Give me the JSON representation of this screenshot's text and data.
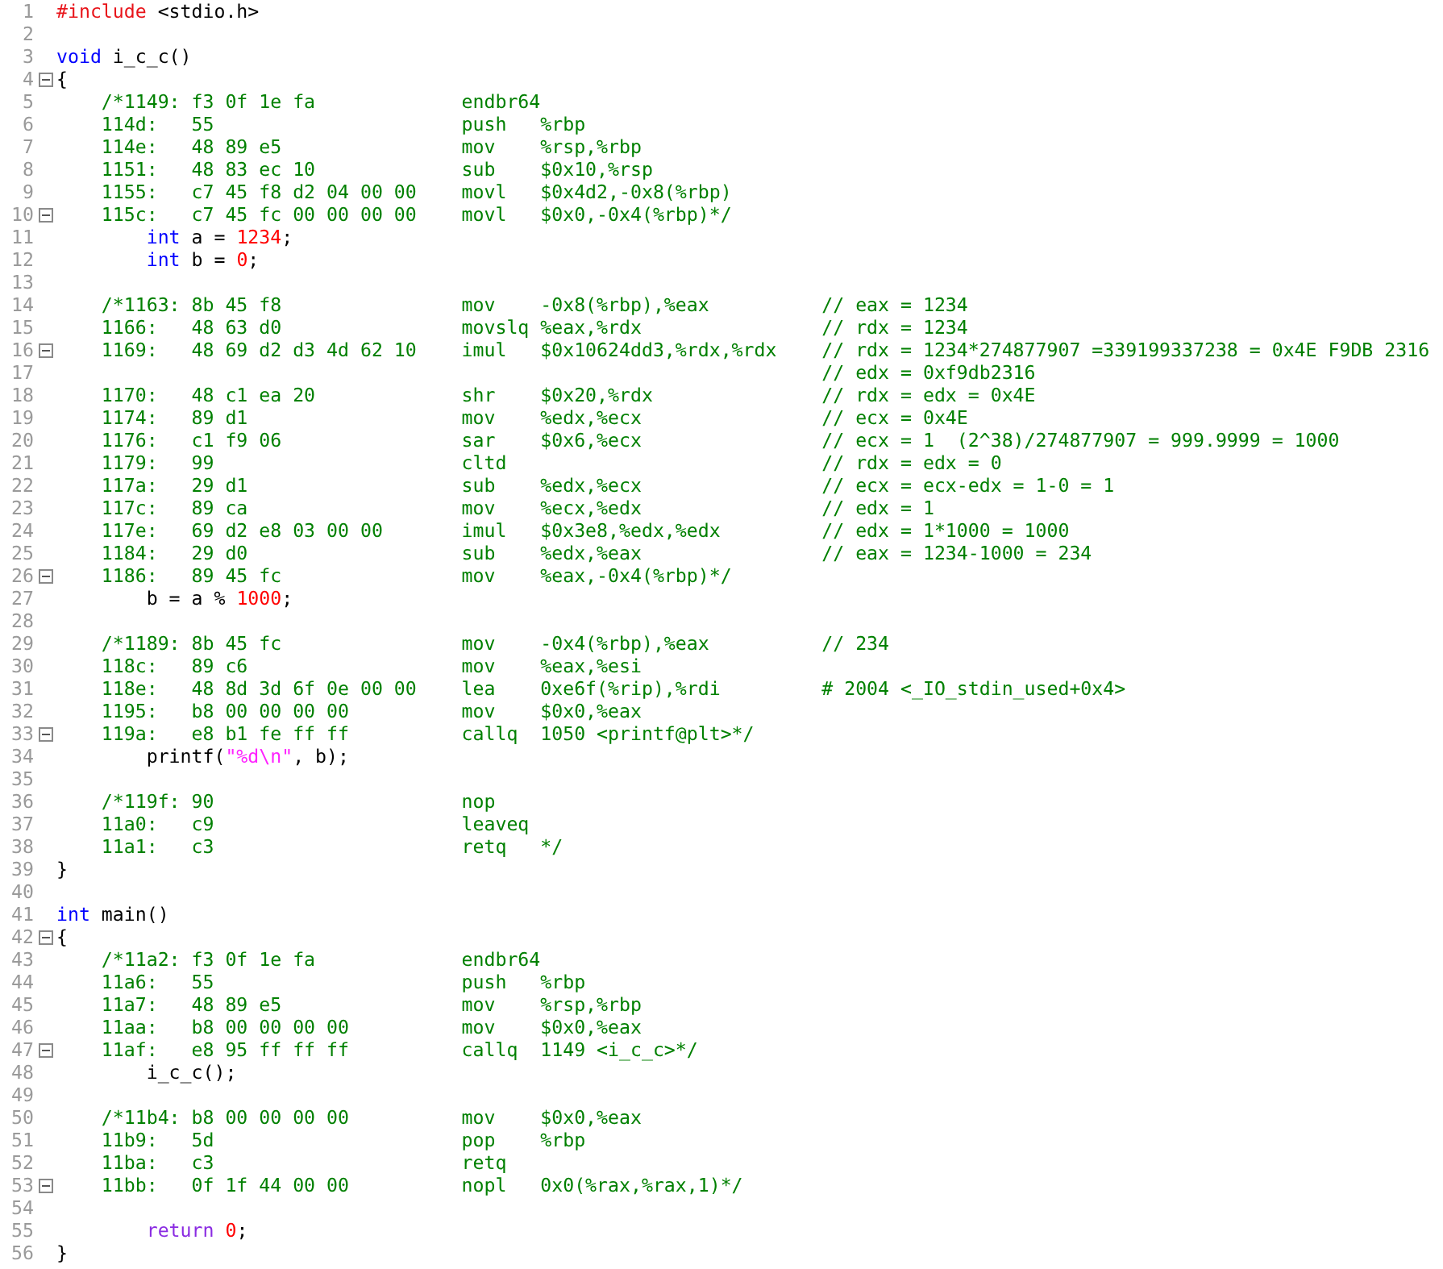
{
  "editor": {
    "lines": [
      {
        "number": "1",
        "fold": false,
        "kind": "source",
        "tokens": [
          {
            "kind": "preproc",
            "text": "#include"
          },
          {
            "kind": "plain",
            "text": " <stdio.h>"
          }
        ]
      },
      {
        "number": "2",
        "fold": false,
        "kind": "blank"
      },
      {
        "number": "3",
        "fold": false,
        "kind": "source",
        "tokens": [
          {
            "kind": "keyword",
            "text": "void"
          },
          {
            "kind": "plain",
            "text": " i_c_c()"
          }
        ]
      },
      {
        "number": "4",
        "fold": true,
        "kind": "source",
        "tokens": [
          {
            "kind": "plain",
            "text": "{"
          }
        ]
      },
      {
        "number": "5",
        "fold": false,
        "kind": "asm",
        "addr": "/*1149:",
        "bytes": "f3 0f 1e fa",
        "op": "endbr64"
      },
      {
        "number": "6",
        "fold": false,
        "kind": "asm",
        "addr": "114d:",
        "bytes": "55",
        "op": "push",
        "args": "%rbp"
      },
      {
        "number": "7",
        "fold": false,
        "kind": "asm",
        "addr": "114e:",
        "bytes": "48 89 e5",
        "op": "mov",
        "args": "%rsp,%rbp"
      },
      {
        "number": "8",
        "fold": false,
        "kind": "asm",
        "addr": "1151:",
        "bytes": "48 83 ec 10",
        "op": "sub",
        "args": "$0x10,%rsp"
      },
      {
        "number": "9",
        "fold": false,
        "kind": "asm",
        "addr": "1155:",
        "bytes": "c7 45 f8 d2 04 00 00",
        "op": "movl",
        "args": "$0x4d2,-0x8(%rbp)"
      },
      {
        "number": "10",
        "fold": true,
        "kind": "asm",
        "addr": "115c:",
        "bytes": "c7 45 fc 00 00 00 00",
        "op": "movl",
        "args": "$0x0,-0x4(%rbp)*/"
      },
      {
        "number": "11",
        "fold": false,
        "kind": "source",
        "tokens": [
          {
            "kind": "keyword",
            "text": "        int"
          },
          {
            "kind": "plain",
            "text": " a = "
          },
          {
            "kind": "number",
            "text": "1234"
          },
          {
            "kind": "plain",
            "text": ";"
          }
        ]
      },
      {
        "number": "12",
        "fold": false,
        "kind": "source",
        "tokens": [
          {
            "kind": "keyword",
            "text": "        int"
          },
          {
            "kind": "plain",
            "text": " b = "
          },
          {
            "kind": "number",
            "text": "0"
          },
          {
            "kind": "plain",
            "text": ";"
          }
        ]
      },
      {
        "number": "13",
        "fold": false,
        "kind": "blank"
      },
      {
        "number": "14",
        "fold": false,
        "kind": "asm",
        "addr": "/*1163:",
        "bytes": "8b 45 f8",
        "op": "mov",
        "args": "-0x8(%rbp),%eax",
        "note": "// eax = 1234"
      },
      {
        "number": "15",
        "fold": false,
        "kind": "asm",
        "addr": "1166:",
        "bytes": "48 63 d0",
        "op": "movslq",
        "args": "%eax,%rdx",
        "note": "// rdx = 1234"
      },
      {
        "number": "16",
        "fold": true,
        "kind": "asm",
        "addr": "1169:",
        "bytes": "48 69 d2 d3 4d 62 10",
        "op": "imul",
        "args": "$0x10624dd3,%rdx,%rdx",
        "note": "// rdx = 1234*274877907 =339199337238 = 0x4E F9DB 2316"
      },
      {
        "number": "17",
        "fold": false,
        "kind": "note",
        "note": "// edx = 0xf9db2316"
      },
      {
        "number": "18",
        "fold": false,
        "kind": "asm",
        "addr": "1170:",
        "bytes": "48 c1 ea 20",
        "op": "shr",
        "args": "$0x20,%rdx",
        "note": "// rdx = edx = 0x4E"
      },
      {
        "number": "19",
        "fold": false,
        "kind": "asm",
        "addr": "1174:",
        "bytes": "89 d1",
        "op": "mov",
        "args": "%edx,%ecx",
        "note": "// ecx = 0x4E"
      },
      {
        "number": "20",
        "fold": false,
        "kind": "asm",
        "addr": "1176:",
        "bytes": "c1 f9 06",
        "op": "sar",
        "args": "$0x6,%ecx",
        "note": "// ecx = 1  (2^38)/274877907 = 999.9999 = 1000"
      },
      {
        "number": "21",
        "fold": false,
        "kind": "asm",
        "addr": "1179:",
        "bytes": "99",
        "op": "cltd",
        "note": "// rdx = edx = 0"
      },
      {
        "number": "22",
        "fold": false,
        "kind": "asm",
        "addr": "117a:",
        "bytes": "29 d1",
        "op": "sub",
        "args": "%edx,%ecx",
        "note": "// ecx = ecx-edx = 1-0 = 1"
      },
      {
        "number": "23",
        "fold": false,
        "kind": "asm",
        "addr": "117c:",
        "bytes": "89 ca",
        "op": "mov",
        "args": "%ecx,%edx",
        "note": "// edx = 1"
      },
      {
        "number": "24",
        "fold": false,
        "kind": "asm",
        "addr": "117e:",
        "bytes": "69 d2 e8 03 00 00",
        "op": "imul",
        "args": "$0x3e8,%edx,%edx",
        "note": "// edx = 1*1000 = 1000"
      },
      {
        "number": "25",
        "fold": false,
        "kind": "asm",
        "addr": "1184:",
        "bytes": "29 d0",
        "op": "sub",
        "args": "%edx,%eax",
        "note": "// eax = 1234-1000 = 234"
      },
      {
        "number": "26",
        "fold": true,
        "kind": "asm",
        "addr": "1186:",
        "bytes": "89 45 fc",
        "op": "mov",
        "args": "%eax,-0x4(%rbp)*/"
      },
      {
        "number": "27",
        "fold": false,
        "kind": "source",
        "tokens": [
          {
            "kind": "plain",
            "text": "        b = a % "
          },
          {
            "kind": "number",
            "text": "1000"
          },
          {
            "kind": "plain",
            "text": ";"
          }
        ]
      },
      {
        "number": "28",
        "fold": false,
        "kind": "blank"
      },
      {
        "number": "29",
        "fold": false,
        "kind": "asm",
        "addr": "/*1189:",
        "bytes": "8b 45 fc",
        "op": "mov",
        "args": "-0x4(%rbp),%eax",
        "note": "// 234"
      },
      {
        "number": "30",
        "fold": false,
        "kind": "asm",
        "addr": "118c:",
        "bytes": "89 c6",
        "op": "mov",
        "args": "%eax,%esi"
      },
      {
        "number": "31",
        "fold": false,
        "kind": "asm",
        "addr": "118e:",
        "bytes": "48 8d 3d 6f 0e 00 00",
        "op": "lea",
        "args": "0xe6f(%rip),%rdi",
        "note": "# 2004 <_IO_stdin_used+0x4>"
      },
      {
        "number": "32",
        "fold": false,
        "kind": "asm",
        "addr": "1195:",
        "bytes": "b8 00 00 00 00",
        "op": "mov",
        "args": "$0x0,%eax"
      },
      {
        "number": "33",
        "fold": true,
        "kind": "asm",
        "addr": "119a:",
        "bytes": "e8 b1 fe ff ff",
        "op": "callq",
        "args": "1050 <printf@plt>*/"
      },
      {
        "number": "34",
        "fold": false,
        "kind": "source",
        "tokens": [
          {
            "kind": "plain",
            "text": "        printf("
          },
          {
            "kind": "string",
            "text": "\"%d\\n\""
          },
          {
            "kind": "plain",
            "text": ", b);"
          }
        ]
      },
      {
        "number": "35",
        "fold": false,
        "kind": "blank"
      },
      {
        "number": "36",
        "fold": false,
        "kind": "asm",
        "addr": "/*119f:",
        "bytes": "90",
        "op": "nop"
      },
      {
        "number": "37",
        "fold": false,
        "kind": "asm",
        "addr": "11a0:",
        "bytes": "c9",
        "op": "leaveq"
      },
      {
        "number": "38",
        "fold": false,
        "kind": "asm",
        "addr": "11a1:",
        "bytes": "c3",
        "op": "retq",
        "args": "*/"
      },
      {
        "number": "39",
        "fold": false,
        "kind": "source",
        "tokens": [
          {
            "kind": "plain",
            "text": "}"
          }
        ]
      },
      {
        "number": "40",
        "fold": false,
        "kind": "blank"
      },
      {
        "number": "41",
        "fold": false,
        "kind": "source",
        "tokens": [
          {
            "kind": "keyword",
            "text": "int"
          },
          {
            "kind": "plain",
            "text": " main()"
          }
        ]
      },
      {
        "number": "42",
        "fold": true,
        "kind": "source",
        "tokens": [
          {
            "kind": "plain",
            "text": "{"
          }
        ]
      },
      {
        "number": "43",
        "fold": false,
        "kind": "asm",
        "addr": "/*11a2:",
        "bytes": "f3 0f 1e fa",
        "op": "endbr64"
      },
      {
        "number": "44",
        "fold": false,
        "kind": "asm",
        "addr": "11a6:",
        "bytes": "55",
        "op": "push",
        "args": "%rbp"
      },
      {
        "number": "45",
        "fold": false,
        "kind": "asm",
        "addr": "11a7:",
        "bytes": "48 89 e5",
        "op": "mov",
        "args": "%rsp,%rbp"
      },
      {
        "number": "46",
        "fold": false,
        "kind": "asm",
        "addr": "11aa:",
        "bytes": "b8 00 00 00 00",
        "op": "mov",
        "args": "$0x0,%eax"
      },
      {
        "number": "47",
        "fold": true,
        "kind": "asm",
        "addr": "11af:",
        "bytes": "e8 95 ff ff ff",
        "op": "callq",
        "args": "1149 <i_c_c>*/"
      },
      {
        "number": "48",
        "fold": false,
        "kind": "source",
        "tokens": [
          {
            "kind": "plain",
            "text": "        i_c_c();"
          }
        ]
      },
      {
        "number": "49",
        "fold": false,
        "kind": "blank"
      },
      {
        "number": "50",
        "fold": false,
        "kind": "asm",
        "addr": "/*11b4:",
        "bytes": "b8 00 00 00 00",
        "op": "mov",
        "args": "$0x0,%eax"
      },
      {
        "number": "51",
        "fold": false,
        "kind": "asm",
        "addr": "11b9:",
        "bytes": "5d",
        "op": "pop",
        "args": "%rbp"
      },
      {
        "number": "52",
        "fold": false,
        "kind": "asm",
        "addr": "11ba:",
        "bytes": "c3",
        "op": "retq"
      },
      {
        "number": "53",
        "fold": true,
        "kind": "asm",
        "addr": "11bb:",
        "bytes": "0f 1f 44 00 00",
        "op": "nopl",
        "args": "0x0(%rax,%rax,1)*/"
      },
      {
        "number": "54",
        "fold": false,
        "kind": "blank"
      },
      {
        "number": "55",
        "fold": false,
        "kind": "source",
        "tokens": [
          {
            "kind": "return",
            "text": "        return "
          },
          {
            "kind": "number",
            "text": "0"
          },
          {
            "kind": "plain",
            "text": ";"
          }
        ]
      },
      {
        "number": "56",
        "fold": false,
        "kind": "source",
        "tokens": [
          {
            "kind": "plain",
            "text": "}"
          }
        ]
      }
    ]
  }
}
